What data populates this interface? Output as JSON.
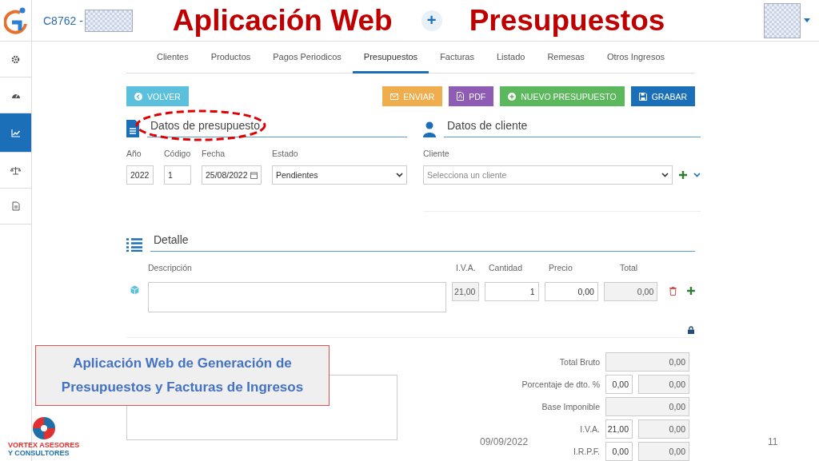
{
  "header": {
    "account": "C8762 -"
  },
  "slide_title": {
    "left": "Aplicación Web",
    "joiner": "+",
    "right": "Presupuestos"
  },
  "sidebar": {
    "items": [
      {
        "kind": "gear",
        "selected": false
      },
      {
        "kind": "gauge",
        "selected": false
      },
      {
        "kind": "chart",
        "selected": true
      },
      {
        "kind": "scale",
        "selected": false
      },
      {
        "kind": "document",
        "selected": false
      }
    ]
  },
  "nav": {
    "tabs": [
      {
        "label": "Clientes",
        "selected": false
      },
      {
        "label": "Productos",
        "selected": false
      },
      {
        "label": "Pagos Periodicos",
        "selected": false
      },
      {
        "label": "Presupuestos",
        "selected": true
      },
      {
        "label": "Facturas",
        "selected": false
      },
      {
        "label": "Listado",
        "selected": false
      },
      {
        "label": "Remesas",
        "selected": false
      },
      {
        "label": "Otros Ingresos",
        "selected": false
      }
    ]
  },
  "toolbar": {
    "back": "VOLVER",
    "actions": [
      {
        "label": "ENVIAR",
        "kind": "mail",
        "color": "#f0ad4e"
      },
      {
        "label": "PDF",
        "kind": "pdf",
        "color": "#8e5bb5"
      },
      {
        "label": "NUEVO PRESUPUESTO",
        "kind": "new",
        "color": "#5cb85c"
      },
      {
        "label": "GRABAR",
        "kind": "save",
        "color": "#1a6fb8"
      }
    ]
  },
  "budget_section": {
    "title": "Datos de presupuesto",
    "fields": [
      {
        "label": "Año",
        "value": "2022",
        "kind": "text"
      },
      {
        "label": "Código",
        "value": "1",
        "kind": "text"
      },
      {
        "label": "Fecha",
        "value": "25/08/2022",
        "kind": "date"
      },
      {
        "label": "Estado",
        "value": "Pendientes",
        "kind": "select"
      }
    ]
  },
  "client_section": {
    "title": "Datos de cliente",
    "field": {
      "label": "Cliente",
      "placeholder": "Selecciona un cliente"
    }
  },
  "detail_section": {
    "title": "Detalle",
    "columns": [
      "Descripción",
      "I.V.A.",
      "Cantidad",
      "Precio",
      "Total"
    ],
    "rows": [
      {
        "cells": [
          {
            "readonly": false
          },
          {
            "value": "21,00",
            "readonly": true
          },
          {
            "value": "1",
            "readonly": false
          },
          {
            "value": "0,00",
            "readonly": false
          },
          {
            "value": "0,00",
            "readonly": true
          }
        ]
      }
    ]
  },
  "totals": [
    {
      "label": "Total Bruto",
      "value": "0,00"
    },
    {
      "label": "Porcentaje de dto. %",
      "rate": "0,00",
      "value": "0,00"
    },
    {
      "label": "Base Imponible",
      "value": "0,00"
    },
    {
      "label": "I.V.A.",
      "rate": "21,00",
      "value": "0,00"
    },
    {
      "label": "I.R.P.F.",
      "rate": "0,00",
      "value": "0,00"
    }
  ],
  "callout": {
    "lines": [
      "Aplicación Web de Generación de",
      "Presupuestos y Facturas de Ingresos"
    ]
  },
  "footer": {
    "logo_lines": [
      "VORTEX ASESORES",
      "Y CONSULTORES"
    ],
    "date": "09/09/2022",
    "page": "11"
  }
}
